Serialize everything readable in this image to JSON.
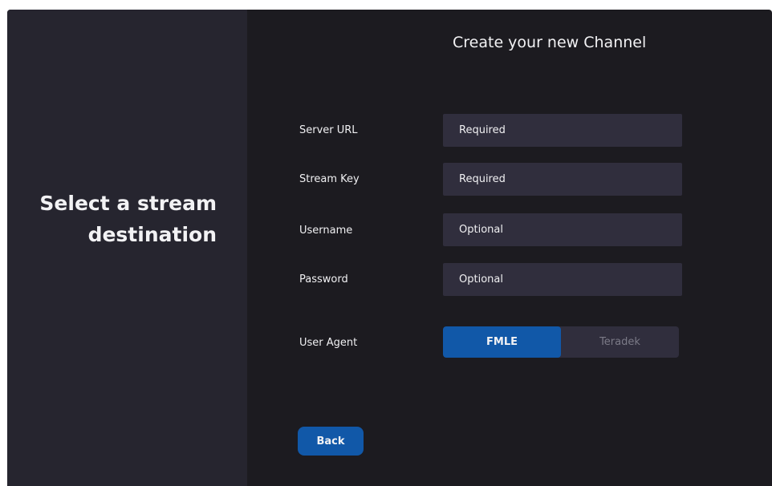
{
  "sidebar": {
    "heading": "Select a stream destination"
  },
  "main": {
    "title": "Create your new Channel",
    "fields": [
      {
        "label": "Server URL",
        "placeholder": "Required",
        "value": ""
      },
      {
        "label": "Stream Key",
        "placeholder": "Required",
        "value": ""
      },
      {
        "label": "Username",
        "placeholder": "Optional",
        "value": ""
      },
      {
        "label": "Password",
        "placeholder": "Optional",
        "value": ""
      }
    ],
    "user_agent": {
      "label": "User Agent",
      "options": [
        "FMLE",
        "Teradek"
      ],
      "selected": "FMLE"
    },
    "back_label": "Back"
  },
  "colors": {
    "background": "#1c1b20",
    "sidebar": "#26252f",
    "input": "#302e3d",
    "accent": "#1158a8",
    "text": "#f2f2f4",
    "muted_text": "#7b7a87"
  }
}
